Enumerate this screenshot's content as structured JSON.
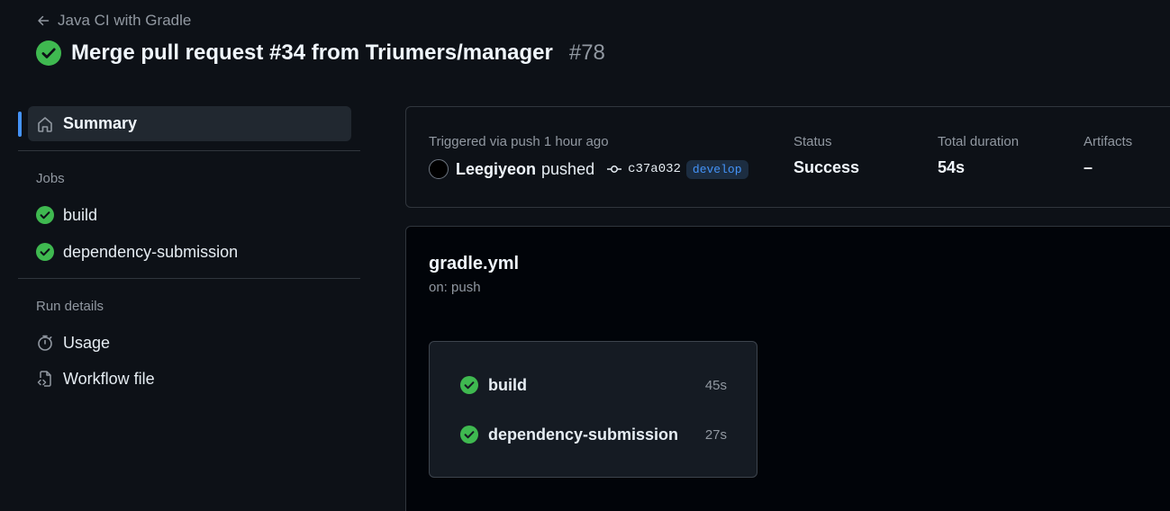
{
  "header": {
    "back_label": "Java CI with Gradle",
    "run_title": "Merge pull request #34 from Triumers/manager",
    "run_number": "#78"
  },
  "sidebar": {
    "summary_label": "Summary",
    "jobs_heading": "Jobs",
    "jobs": [
      {
        "label": "build",
        "status": "success"
      },
      {
        "label": "dependency-submission",
        "status": "success"
      }
    ],
    "run_details_heading": "Run details",
    "run_details": [
      {
        "label": "Usage",
        "icon": "stopwatch-icon"
      },
      {
        "label": "Workflow file",
        "icon": "file-code-icon"
      }
    ]
  },
  "summary": {
    "trigger_text": "Triggered via push 1 hour ago",
    "actor": "Leegiyeon",
    "action": "pushed",
    "commit_sha": "c37a032",
    "branch": "develop",
    "status_label": "Status",
    "status_value": "Success",
    "duration_label": "Total duration",
    "duration_value": "54s",
    "artifacts_label": "Artifacts",
    "artifacts_value": "–"
  },
  "workflow": {
    "file_name": "gradle.yml",
    "trigger": "on: push",
    "jobs": [
      {
        "name": "build",
        "duration": "45s",
        "status": "success"
      },
      {
        "name": "dependency-submission",
        "duration": "27s",
        "status": "success"
      }
    ]
  },
  "colors": {
    "success": "#3fb950",
    "accent": "#4493f8",
    "background": "#0d1117",
    "card_background": "#010409"
  }
}
